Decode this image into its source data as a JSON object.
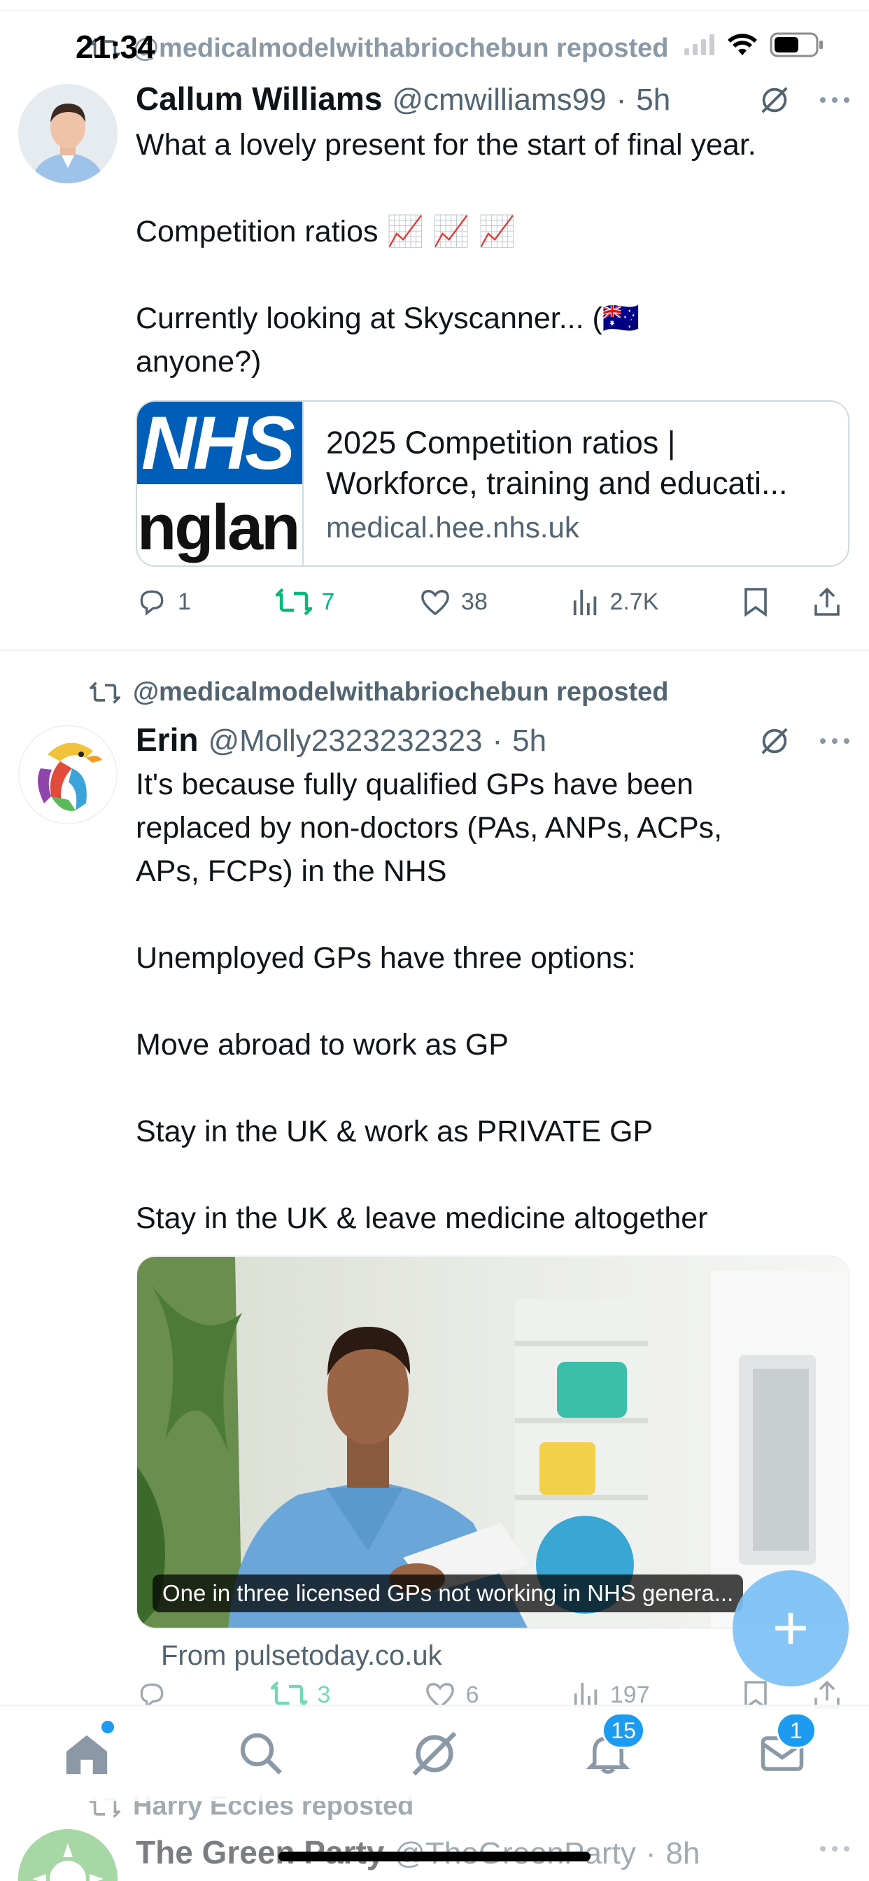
{
  "status_bar": {
    "time": "21:34"
  },
  "tweets": [
    {
      "reposted_by": "@medicalmodelwithabriochebun reposted",
      "name": "Callum Williams",
      "handle": "@cmwilliams99",
      "dot": "·",
      "time": "5h",
      "lines": [
        "What a lovely present for the start of final year.",
        "",
        "Competition ratios 📈 📈 📈",
        "",
        "Currently looking at Skyscanner... (🇦🇺",
        "anyone?)"
      ],
      "link_card": {
        "thumb_top": "NHS",
        "thumb_bottom": "nglan",
        "title_1": "2025 Competition ratios |",
        "title_2": "Workforce, training and educati...",
        "domain": "medical.hee.nhs.uk"
      },
      "counts": {
        "replies": "1",
        "reposts": "7",
        "likes": "38",
        "views": "2.7K"
      }
    },
    {
      "reposted_by": "@medicalmodelwithabriochebun reposted",
      "name": "Erin",
      "handle": "@Molly2323232323",
      "dot": "·",
      "time": "5h",
      "lines": [
        "It's because fully qualified GPs have been",
        "replaced by non-doctors (PAs, ANPs, ACPs,",
        "APs, FCPs) in the NHS",
        "",
        "Unemployed GPs have three options:",
        "",
        "Move abroad to work as GP",
        "",
        "Stay in the UK & work as PRIVATE GP",
        "",
        "Stay in the UK & leave medicine altogether"
      ],
      "media": {
        "caption": "One in three licensed GPs not working in NHS genera...",
        "from": "From pulsetoday.co.uk"
      },
      "counts": {
        "replies": "",
        "reposts": "3",
        "likes": "6",
        "views": "197"
      }
    },
    {
      "reposted_by": "Harry Eccles reposted",
      "name": "The Green Party",
      "handle": "@TheGreenParty",
      "dot": "·",
      "time": "8h"
    }
  ],
  "tabbar": {
    "notifications_badge": "15",
    "messages_badge": "1"
  },
  "colors": {
    "accent": "#1d9bf0",
    "retweet_green": "#00ba7c",
    "muted": "#536471",
    "nhs_blue": "#005eb8"
  },
  "icons": [
    "repost-icon",
    "grok-icon",
    "more-icon",
    "reply-icon",
    "retweet-icon",
    "like-icon",
    "views-icon",
    "bookmark-icon",
    "share-icon",
    "home-icon",
    "search-icon",
    "notifications-icon",
    "messages-icon",
    "compose-plus-icon",
    "signal-icon",
    "wifi-icon",
    "battery-icon"
  ]
}
